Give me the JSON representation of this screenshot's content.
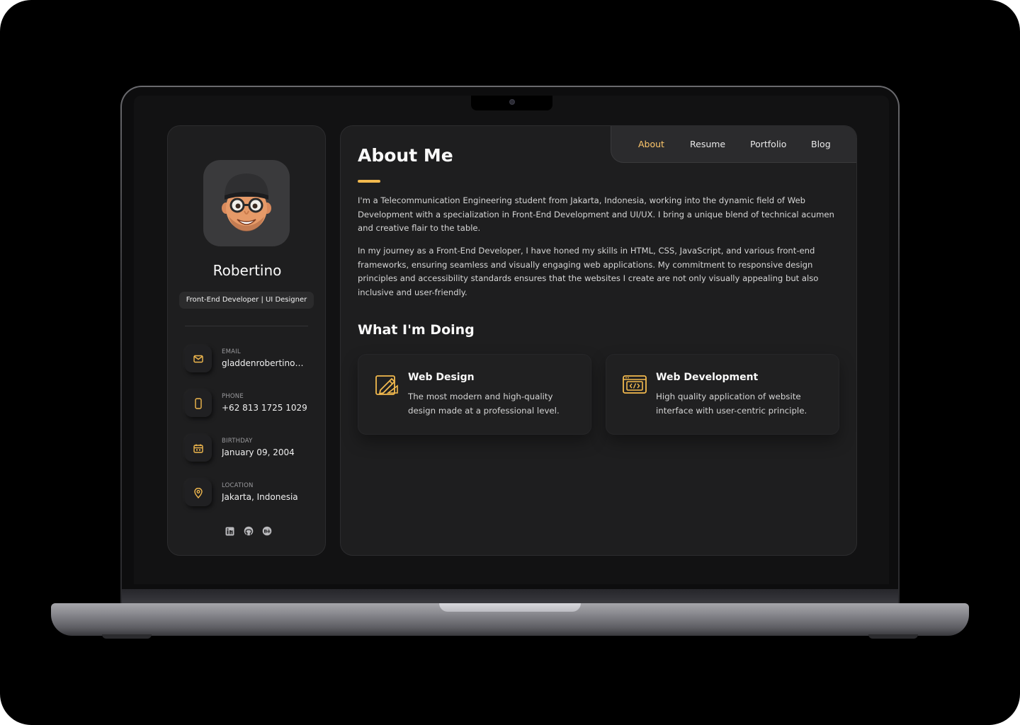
{
  "sidebar": {
    "name": "Robertino",
    "title": "Front-End Developer | UI Designer",
    "contacts": [
      {
        "label": "EMAIL",
        "value": "gladdenrobertino@gmail.com",
        "icon": "mail-icon"
      },
      {
        "label": "PHONE",
        "value": "+62 813 1725 1029",
        "icon": "phone-icon"
      },
      {
        "label": "BIRTHDAY",
        "value": "January 09, 2004",
        "icon": "calendar-icon"
      },
      {
        "label": "LOCATION",
        "value": "Jakarta, Indonesia",
        "icon": "location-pin-icon"
      }
    ],
    "socials": [
      "linkedin-icon",
      "github-icon",
      "behance-icon"
    ]
  },
  "nav": {
    "items": [
      "About",
      "Resume",
      "Portfolio",
      "Blog"
    ],
    "active": "About"
  },
  "about": {
    "title": "About Me",
    "paragraphs": [
      "I'm a Telecommunication Engineering student from Jakarta, Indonesia, working into the dynamic field of Web Development with a specialization in Front-End Development and UI/UX. I bring a unique blend of technical acumen and creative flair to the table.",
      "In my journey as a Front-End Developer, I have honed my skills in HTML, CSS, JavaScript, and various front-end frameworks, ensuring seamless and visually engaging web applications. My commitment to responsive design principles and accessibility standards ensures that the websites I create are not only visually appealing but also inclusive and user-friendly."
    ]
  },
  "doing": {
    "title": "What I'm Doing",
    "services": [
      {
        "title": "Web Design",
        "text": "The most modern and high-quality design made at a professional level.",
        "icon": "design-tools-icon"
      },
      {
        "title": "Web Development",
        "text": "High quality application of website interface with user-centric principle.",
        "icon": "code-window-icon"
      }
    ]
  },
  "colors": {
    "accent": "#f2b94e",
    "nav_active": "#ffc86b",
    "card_bg": "#1e1e1f",
    "page_bg": "#121213"
  }
}
